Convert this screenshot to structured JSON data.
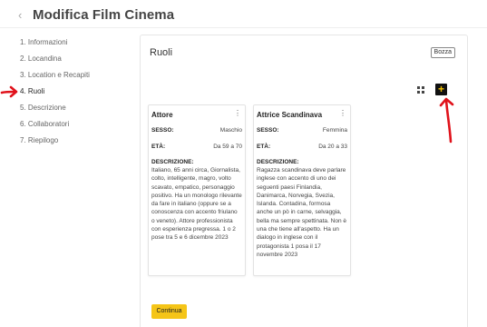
{
  "header": {
    "back_glyph": "‹",
    "title": "Modifica Film Cinema"
  },
  "steps": [
    {
      "label": "1. Informazioni"
    },
    {
      "label": "2. Locandina"
    },
    {
      "label": "3. Location e Recapiti"
    },
    {
      "label": "4. Ruoli"
    },
    {
      "label": "5. Descrizione"
    },
    {
      "label": "6. Collaboratori"
    },
    {
      "label": "7. Riepilogo"
    }
  ],
  "panel": {
    "title": "Ruoli",
    "status_badge": "Bozza",
    "add_glyph": "+",
    "menu_glyph": "⋮"
  },
  "roles": [
    {
      "name": "Attore",
      "sesso_label": "SESSO:",
      "sesso": "Maschio",
      "eta_label": "ETÀ:",
      "eta": "Da 59 a 70",
      "descrizione_label": "DESCRIZIONE:",
      "descrizione": "Italiano, 65 anni circa, Giornalista, colto, intelligente, magro, volto scavato, empatico, personaggio positivo. Ha un monologo rilevante da fare in italiano (oppure se a conoscenza con accento friulano o veneto). Attore professionista con esperienza pregressa. 1 o 2 pose tra 5 e 6 dicembre 2023"
    },
    {
      "name": "Attrice Scandinava",
      "sesso_label": "SESSO:",
      "sesso": "Femmina",
      "eta_label": "ETÀ:",
      "eta": "Da 20 a 33",
      "descrizione_label": "DESCRIZIONE:",
      "descrizione": "Ragazza scandinava deve parlare inglese con accento di uno dei seguenti paesi Finlandia, Danimarca, Norvegia, Svezia, Islanda. Contadina, formosa anche un pò in carne, selvaggia, bella ma sempre spettinata. Non è una che tiene all'aspetto. Ha un dialogo in inglese con il protagonista 1 posa il 17 novembre 2023"
    }
  ],
  "footer": {
    "continue_label": "Continua"
  },
  "colors": {
    "accent": "#f5c518",
    "annotation_red": "#e0121b"
  },
  "icons": {
    "back": "chevron-left-icon",
    "grid": "grid-view-icon",
    "add": "plus-icon",
    "menu": "kebab-menu-icon"
  }
}
